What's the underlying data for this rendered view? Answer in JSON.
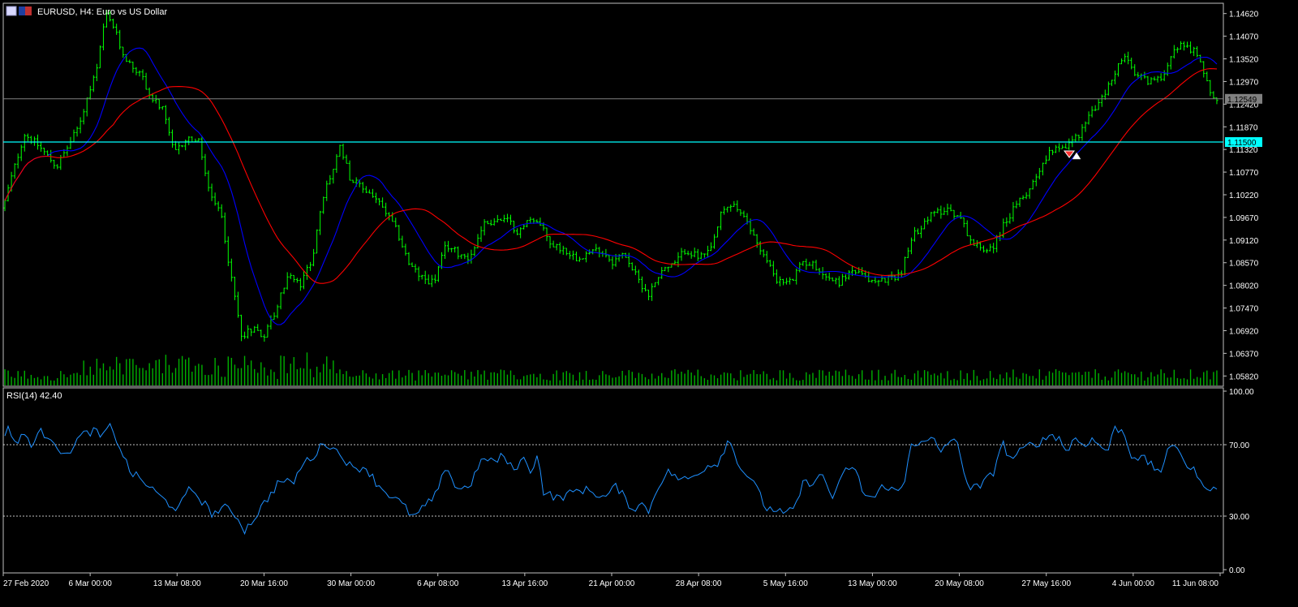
{
  "header": {
    "symbol_info": "EURUSD, H4:  Euro vs US Dollar",
    "rsi_label": "RSI(14) 42.40"
  },
  "colors": {
    "background": "#000000",
    "axis": "#c0c0c0",
    "bull_candle": "#00ff00",
    "volume": "#00b000",
    "ma_fast": "#0000ff",
    "ma_slow": "#ff0000",
    "rsi_line": "#1e90ff",
    "support_line": "#00ffff",
    "price_line": "#808080",
    "level_dash": "#ffffff"
  },
  "chart_data": [
    {
      "type": "candlestick",
      "price_ticks": [
        "1.14620",
        "1.14070",
        "1.13520",
        "1.12970",
        "1.12420",
        "1.11870",
        "1.11320",
        "1.10770",
        "1.10220",
        "1.09670",
        "1.09120",
        "1.08570",
        "1.08020",
        "1.07470",
        "1.06920",
        "1.06370",
        "1.05820"
      ],
      "ylim": [
        1.0557,
        1.1487
      ],
      "current_price_label": "1.12549",
      "current_price": 1.12549,
      "horizontal_level_label": "1.11500",
      "horizontal_level": 1.115,
      "date_ticks": [
        "27 Feb 2020",
        "6 Mar 00:00",
        "13 Mar 08:00",
        "20 Mar 16:00",
        "30 Mar 00:00",
        "6 Apr 08:00",
        "13 Apr 16:00",
        "21 Apr 00:00",
        "28 Apr 08:00",
        "5 May 16:00",
        "13 May 00:00",
        "20 May 08:00",
        "27 May 16:00",
        "4 Jun 00:00",
        "11 Jun 08:00"
      ],
      "bar_count": 370,
      "anchors": [
        [
          0,
          1.096
        ],
        [
          12,
          1.105
        ],
        [
          30,
          1.117
        ],
        [
          48,
          1.114
        ],
        [
          70,
          1.109
        ],
        [
          95,
          1.118
        ],
        [
          120,
          1.133
        ],
        [
          130,
          1.146
        ],
        [
          140,
          1.143
        ],
        [
          150,
          1.137
        ],
        [
          160,
          1.134
        ],
        [
          175,
          1.131
        ],
        [
          185,
          1.126
        ],
        [
          200,
          1.123
        ],
        [
          215,
          1.112
        ],
        [
          230,
          1.116
        ],
        [
          245,
          1.115
        ],
        [
          260,
          1.101
        ],
        [
          272,
          1.098
        ],
        [
          285,
          1.082
        ],
        [
          298,
          1.068
        ],
        [
          312,
          1.07
        ],
        [
          325,
          1.068
        ],
        [
          340,
          1.074
        ],
        [
          355,
          1.083
        ],
        [
          370,
          1.08
        ],
        [
          385,
          1.087
        ],
        [
          400,
          1.103
        ],
        [
          410,
          1.108
        ],
        [
          420,
          1.114
        ],
        [
          432,
          1.106
        ],
        [
          445,
          1.104
        ],
        [
          460,
          1.102
        ],
        [
          475,
          1.098
        ],
        [
          490,
          1.093
        ],
        [
          505,
          1.085
        ],
        [
          520,
          1.082
        ],
        [
          535,
          1.081
        ],
        [
          550,
          1.09
        ],
        [
          565,
          1.088
        ],
        [
          580,
          1.087
        ],
        [
          595,
          1.095
        ],
        [
          610,
          1.096
        ],
        [
          625,
          1.096
        ],
        [
          640,
          1.093
        ],
        [
          655,
          1.097
        ],
        [
          665,
          1.095
        ],
        [
          680,
          1.09
        ],
        [
          695,
          1.089
        ],
        [
          710,
          1.087
        ],
        [
          725,
          1.088
        ],
        [
          740,
          1.089
        ],
        [
          755,
          1.086
        ],
        [
          770,
          1.088
        ],
        [
          785,
          1.082
        ],
        [
          800,
          1.078
        ],
        [
          815,
          1.084
        ],
        [
          830,
          1.085
        ],
        [
          845,
          1.089
        ],
        [
          860,
          1.087
        ],
        [
          875,
          1.088
        ],
        [
          890,
          1.098
        ],
        [
          905,
          1.1
        ],
        [
          918,
          1.096
        ],
        [
          930,
          1.092
        ],
        [
          945,
          1.086
        ],
        [
          960,
          1.081
        ],
        [
          975,
          1.081
        ],
        [
          990,
          1.086
        ],
        [
          1005,
          1.085
        ],
        [
          1020,
          1.082
        ],
        [
          1035,
          1.081
        ],
        [
          1050,
          1.084
        ],
        [
          1065,
          1.082
        ],
        [
          1080,
          1.081
        ],
        [
          1095,
          1.082
        ],
        [
          1110,
          1.083
        ],
        [
          1125,
          1.092
        ],
        [
          1140,
          1.096
        ],
        [
          1155,
          1.098
        ],
        [
          1170,
          1.099
        ],
        [
          1185,
          1.096
        ],
        [
          1200,
          1.09
        ],
        [
          1215,
          1.089
        ],
        [
          1225,
          1.09
        ],
        [
          1240,
          1.096
        ],
        [
          1255,
          1.1
        ],
        [
          1270,
          1.104
        ],
        [
          1285,
          1.11
        ],
        [
          1300,
          1.114
        ],
        [
          1315,
          1.114
        ],
        [
          1330,
          1.117
        ],
        [
          1345,
          1.122
        ],
        [
          1360,
          1.126
        ],
        [
          1372,
          1.131
        ],
        [
          1385,
          1.136
        ],
        [
          1400,
          1.131
        ],
        [
          1415,
          1.13
        ],
        [
          1430,
          1.13
        ],
        [
          1445,
          1.137
        ],
        [
          1460,
          1.139
        ],
        [
          1472,
          1.137
        ],
        [
          1485,
          1.132
        ],
        [
          1495,
          1.125
        ],
        [
          1502,
          1.1255
        ]
      ]
    },
    {
      "type": "line",
      "series": [
        {
          "name": "RSI(14)"
        }
      ],
      "y_ticks": [
        "100.00",
        "70.00",
        "30.00",
        "0.00"
      ],
      "ylim": [
        0,
        100
      ],
      "levels": [
        70,
        30
      ],
      "anchors": [
        [
          0,
          73
        ],
        [
          10,
          80
        ],
        [
          20,
          70
        ],
        [
          30,
          76
        ],
        [
          40,
          70
        ],
        [
          50,
          77
        ],
        [
          65,
          74
        ],
        [
          80,
          62
        ],
        [
          90,
          70
        ],
        [
          100,
          75
        ],
        [
          115,
          78
        ],
        [
          125,
          74
        ],
        [
          135,
          80
        ],
        [
          145,
          72
        ],
        [
          160,
          55
        ],
        [
          175,
          50
        ],
        [
          190,
          44
        ],
        [
          205,
          38
        ],
        [
          220,
          34
        ],
        [
          235,
          46
        ],
        [
          250,
          38
        ],
        [
          262,
          31
        ],
        [
          275,
          35
        ],
        [
          290,
          31
        ],
        [
          302,
          22
        ],
        [
          315,
          30
        ],
        [
          330,
          40
        ],
        [
          345,
          50
        ],
        [
          360,
          48
        ],
        [
          375,
          60
        ],
        [
          390,
          65
        ],
        [
          400,
          72
        ],
        [
          410,
          68
        ],
        [
          422,
          64
        ],
        [
          435,
          56
        ],
        [
          450,
          58
        ],
        [
          465,
          48
        ],
        [
          480,
          42
        ],
        [
          495,
          37
        ],
        [
          510,
          29
        ],
        [
          525,
          36
        ],
        [
          540,
          43
        ],
        [
          550,
          60
        ],
        [
          560,
          47
        ],
        [
          570,
          45
        ],
        [
          580,
          48
        ],
        [
          590,
          58
        ],
        [
          600,
          63
        ],
        [
          610,
          60
        ],
        [
          620,
          64
        ],
        [
          632,
          56
        ],
        [
          645,
          62
        ],
        [
          655,
          55
        ],
        [
          662,
          65
        ],
        [
          670,
          44
        ],
        [
          685,
          40
        ],
        [
          700,
          42
        ],
        [
          715,
          45
        ],
        [
          730,
          44
        ],
        [
          745,
          40
        ],
        [
          760,
          47
        ],
        [
          770,
          40
        ],
        [
          780,
          34
        ],
        [
          790,
          37
        ],
        [
          800,
          33
        ],
        [
          812,
          48
        ],
        [
          825,
          55
        ],
        [
          840,
          50
        ],
        [
          855,
          52
        ],
        [
          870,
          58
        ],
        [
          885,
          60
        ],
        [
          898,
          73
        ],
        [
          906,
          65
        ],
        [
          915,
          55
        ],
        [
          925,
          52
        ],
        [
          935,
          43
        ],
        [
          945,
          34
        ],
        [
          955,
          34
        ],
        [
          965,
          31
        ],
        [
          978,
          33
        ],
        [
          990,
          48
        ],
        [
          1005,
          50
        ],
        [
          1015,
          53
        ],
        [
          1025,
          40
        ],
        [
          1035,
          48
        ],
        [
          1045,
          58
        ],
        [
          1055,
          55
        ],
        [
          1065,
          42
        ],
        [
          1078,
          40
        ],
        [
          1090,
          48
        ],
        [
          1105,
          43
        ],
        [
          1115,
          48
        ],
        [
          1122,
          72
        ],
        [
          1135,
          70
        ],
        [
          1150,
          73
        ],
        [
          1160,
          66
        ],
        [
          1170,
          73
        ],
        [
          1180,
          70
        ],
        [
          1195,
          45
        ],
        [
          1210,
          47
        ],
        [
          1225,
          55
        ],
        [
          1235,
          72
        ],
        [
          1245,
          62
        ],
        [
          1258,
          66
        ],
        [
          1270,
          70
        ],
        [
          1285,
          72
        ],
        [
          1295,
          76
        ],
        [
          1305,
          74
        ],
        [
          1315,
          66
        ],
        [
          1325,
          74
        ],
        [
          1335,
          70
        ],
        [
          1345,
          73
        ],
        [
          1355,
          70
        ],
        [
          1365,
          66
        ],
        [
          1375,
          80
        ],
        [
          1385,
          77
        ],
        [
          1395,
          64
        ],
        [
          1410,
          62
        ],
        [
          1420,
          58
        ],
        [
          1430,
          55
        ],
        [
          1440,
          66
        ],
        [
          1450,
          70
        ],
        [
          1458,
          64
        ],
        [
          1465,
          56
        ],
        [
          1475,
          55
        ],
        [
          1485,
          43
        ],
        [
          1495,
          48
        ],
        [
          1502,
          47
        ]
      ]
    }
  ]
}
